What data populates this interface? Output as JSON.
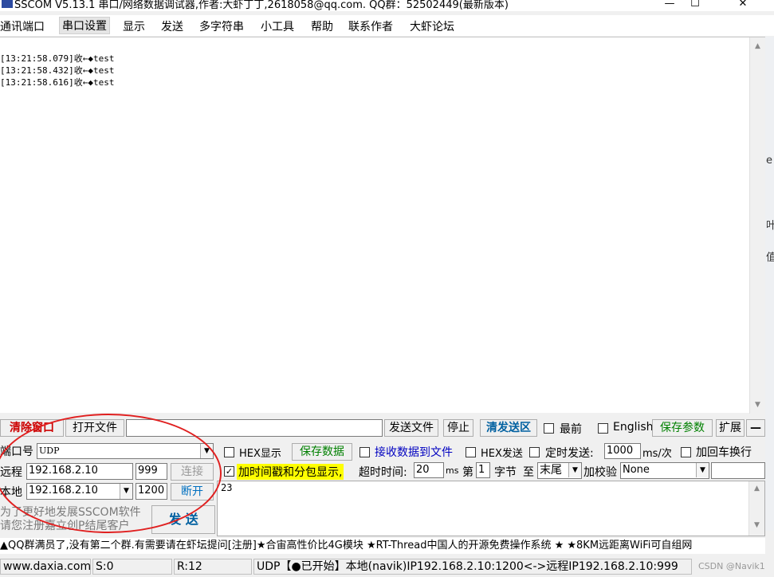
{
  "titlebar": {
    "title": "SSCOM V5.13.1 串口/网络数据调试器,作者:大虾丁丁,2618058@qq.com. QQ群：52502449(最新版本)",
    "minimize": "—",
    "maximize": "☐",
    "close": "✕"
  },
  "menu": [
    "通讯端口",
    "串口设置",
    "显示",
    "发送",
    "多字符串",
    "小工具",
    "帮助",
    "联系作者",
    "大虾论坛"
  ],
  "log": [
    {
      "time": "[13:21:58.079]",
      "dir": "收←◆",
      "text": "test"
    },
    {
      "time": "[13:21:58.432]",
      "dir": "收←◆",
      "text": "test"
    },
    {
      "time": "[13:21:58.616]",
      "dir": "收←◆",
      "text": "test"
    }
  ],
  "toolbar": {
    "clear": "清除窗口",
    "open_file": "打开文件",
    "send_file": "发送文件",
    "stop": "停止",
    "clear_send": "清发送区",
    "front": "最前",
    "english": "English",
    "save_params": "保存参数",
    "expand": "扩展",
    "collapse": "—"
  },
  "port": {
    "label": "端口号",
    "value": "UDP",
    "remote_label": "远程",
    "remote_ip": "192.168.2.10",
    "remote_port": "999",
    "connect": "连接",
    "local_label": "本地",
    "local_ip": "192.168.2.10",
    "local_port": "1200",
    "disconnect": "断开",
    "note1": "为了更好地发展SSCOM软件",
    "note2": "请您注册嘉立创P结尾客户",
    "send": "发 送"
  },
  "options": {
    "hex_display": "HEX显示",
    "save_data": "保存数据",
    "recv_to_file": "接收数据到文件",
    "hex_send": "HEX发送",
    "timed_send": "定时发送:",
    "interval": "1000",
    "interval_unit": "ms/次",
    "add_crlf": "加回车换行",
    "timestamp": "加时间戳和分包显示,",
    "timeout_label": "超时时间:",
    "timeout": "20",
    "timeout_unit": "ms",
    "nth": "第",
    "nth_value": "1",
    "byte": "字节",
    "to": "至",
    "end": "末尾",
    "checksum_label": "加校验",
    "checksum": "None"
  },
  "send_text": "23",
  "ticker": "▲QQ群满员了,没有第二个群.有需要请在虾坛提问[注册]★合宙高性价比4G模块 ★RT-Thread中国人的开源免费操作系统 ★ ★8KM远距离WiFi可自组网",
  "status": {
    "website": "www.daxia.com",
    "s": "S:0",
    "r": "R:12",
    "info": "UDP【●已开始】本地(navik)IP192.168.2.10:1200<->远程IP192.168.2.10:999",
    "watermark": "CSDN @Navik1"
  },
  "right_strip": [
    "e",
    "叶",
    "值"
  ]
}
